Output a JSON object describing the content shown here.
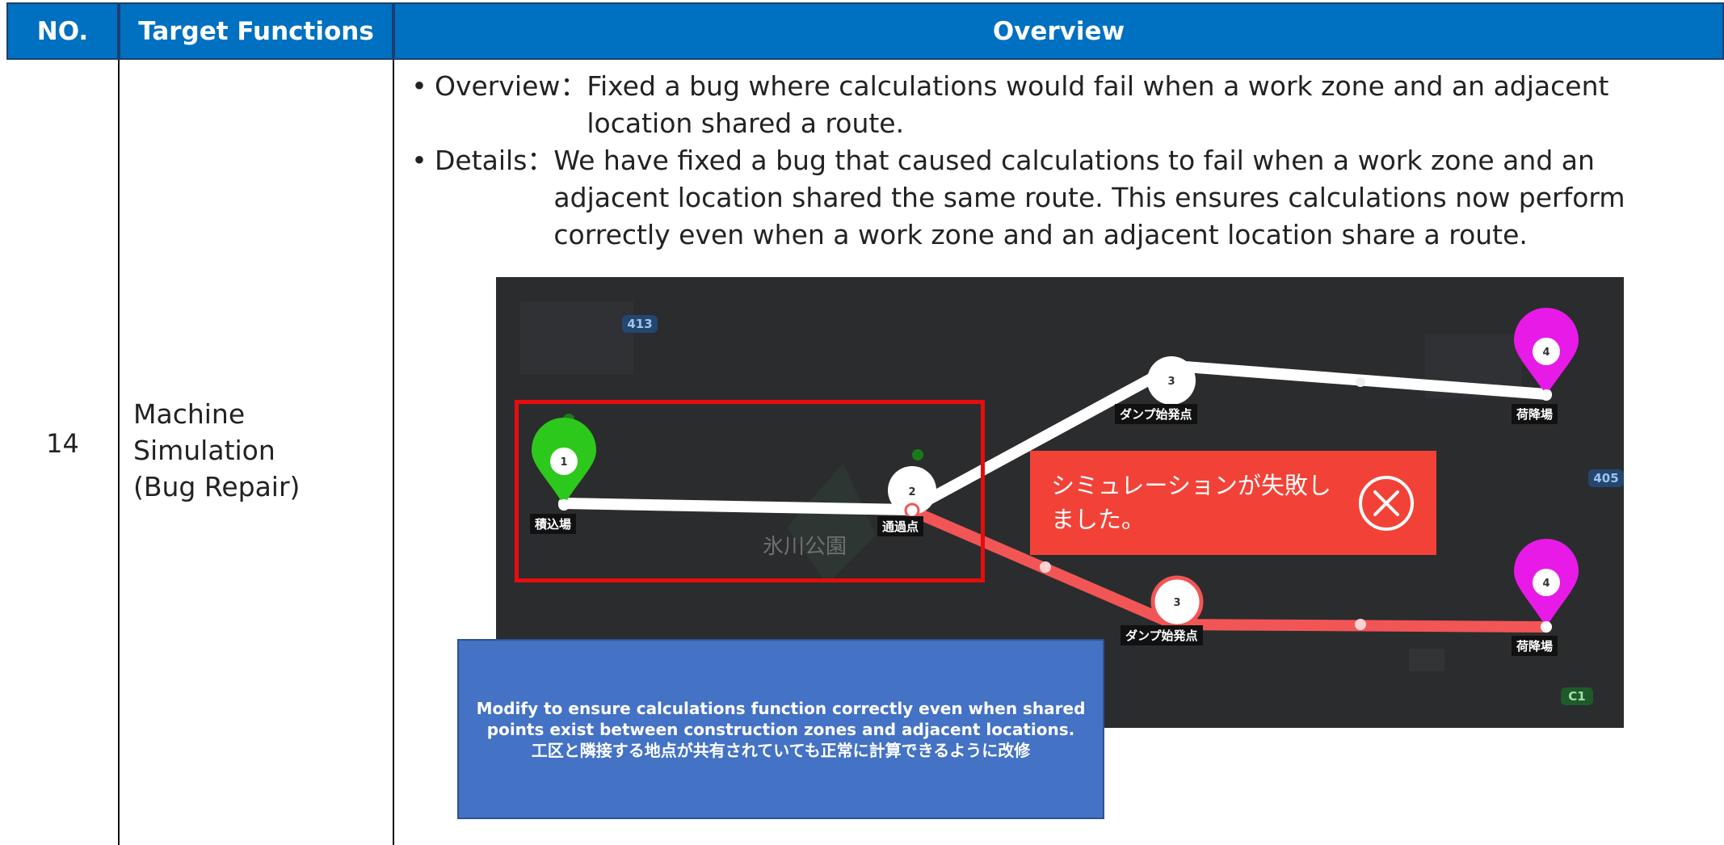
{
  "table": {
    "headers": {
      "no": "NO.",
      "target": "Target Functions",
      "overview": "Overview"
    },
    "row": {
      "no": "14",
      "target_lines": [
        "Machine",
        "Simulation",
        "(Bug Repair)"
      ],
      "overview_key": "Overview：",
      "overview_text": "Fixed a bug where calculations would fail when a work zone and an adjacent location shared a route.",
      "details_key": "Details：",
      "details_text": "We have fixed a bug that caused calculations to fail when a work zone and an adjacent location shared the same route. This ensures calculations now perform correctly even when a work zone and an adjacent location share a route."
    }
  },
  "map": {
    "road_badges": [
      "413",
      "405",
      "C1"
    ],
    "park_label": "氷川公園",
    "labels": {
      "loading": "積込場",
      "waypoint": "通過点",
      "dump_start_top": "ダンプ始発点",
      "dump_start_bottom": "ダンプ始発点",
      "unload_top": "荷降場",
      "unload_bottom": "荷降場"
    },
    "pin_numbers": {
      "loading": "1",
      "waypoint": "2",
      "dump_top": "3",
      "dump_bottom": "3",
      "unload_top": "4",
      "unload_bottom": "4"
    },
    "error_message": "シミュレーションが失敗しました。",
    "error_icon": "close-circle-icon",
    "colors": {
      "route_ok": "#ffffff",
      "route_fail": "#f25555",
      "pin_loading": "#2cc81c",
      "pin_unload": "#e81ae8",
      "error_bg": "#f24237",
      "highlight": "#e60d0d"
    }
  },
  "callout": {
    "line1": "Modify to ensure calculations function correctly even when shared points exist between construction zones and adjacent locations.",
    "line2": "工区と隣接する地点が共有されていても正常に計算できるように改修"
  },
  "header_color": "#0070c0",
  "callout_color": "#4472c4"
}
